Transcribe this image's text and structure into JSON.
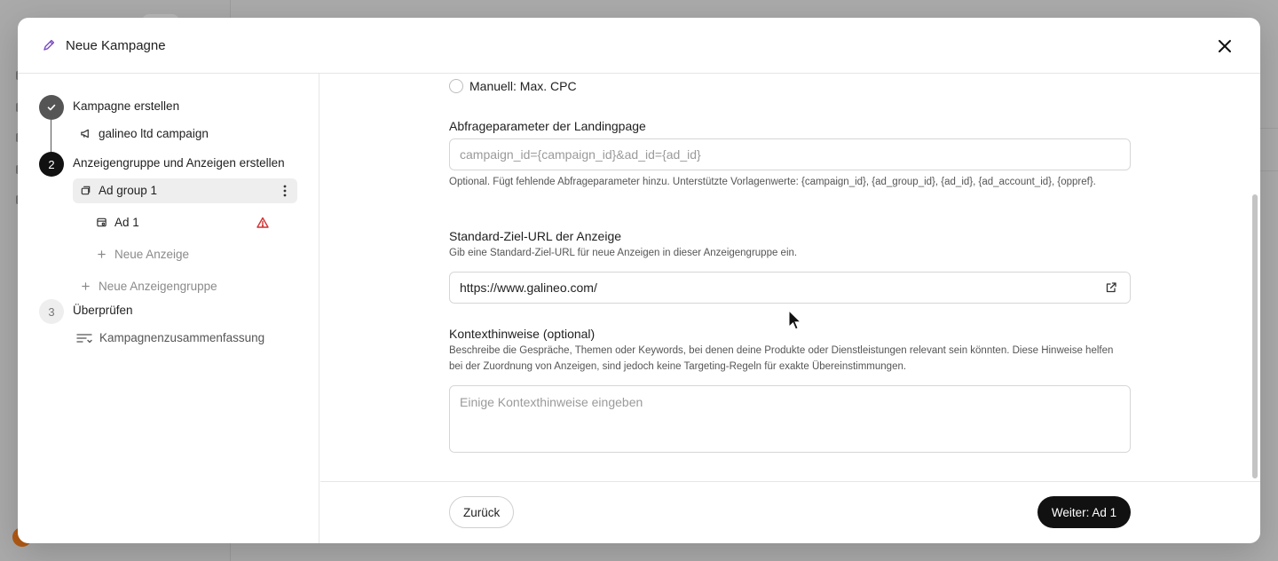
{
  "modal": {
    "title": "Neue Kampagne",
    "close_icon": "close-icon"
  },
  "steps": [
    {
      "number": "✓",
      "label": "Kampagne erstellen",
      "state": "done"
    },
    {
      "number": "2",
      "label": "Anzeigengruppe und Anzeigen erstellen",
      "state": "active"
    },
    {
      "number": "3",
      "label": "Überprüfen",
      "state": "pending"
    }
  ],
  "nav": {
    "campaign_name": "galineo ltd campaign",
    "ad_group": "Ad group 1",
    "ad": "Ad 1",
    "new_ad": "Neue Anzeige",
    "new_ad_group": "Neue Anzeigengruppe",
    "summary": "Kampagnenzusammenfassung"
  },
  "form": {
    "bid_option": "Manuell: Max. CPC",
    "query_label": "Abfrageparameter der Landingpage",
    "query_placeholder": "campaign_id={campaign_id}&ad_id={ad_id}",
    "query_help": "Optional. Fügt fehlende Abfrageparameter hinzu. Unterstützte Vorlagenwerte: {campaign_id}, {ad_group_id}, {ad_id}, {ad_account_id}, {oppref}.",
    "url_label": "Standard-Ziel-URL der Anzeige",
    "url_help": "Gib eine Standard-Ziel-URL für neue Anzeigen in dieser Anzeigengruppe ein.",
    "url_value": "https://www.galineo.com/",
    "context_label": "Kontexthinweise (optional)",
    "context_help": "Beschreibe die Gespräche, Themen oder Keywords, bei denen deine Produkte oder Dienstleistungen relevant sein könnten. Diese Hinweise helfen bei der Zuordnung von Anzeigen, sind jedoch keine Targeting-Regeln für exakte Übereinstimmungen.",
    "context_placeholder": "Einige Kontexthinweise eingeben"
  },
  "footer": {
    "back_label": "Zurück",
    "next_label": "Weiter: Ad 1"
  },
  "colors": {
    "primary": "#111111",
    "warning": "#d32f2f",
    "title_icon": "#7b4bc4"
  }
}
